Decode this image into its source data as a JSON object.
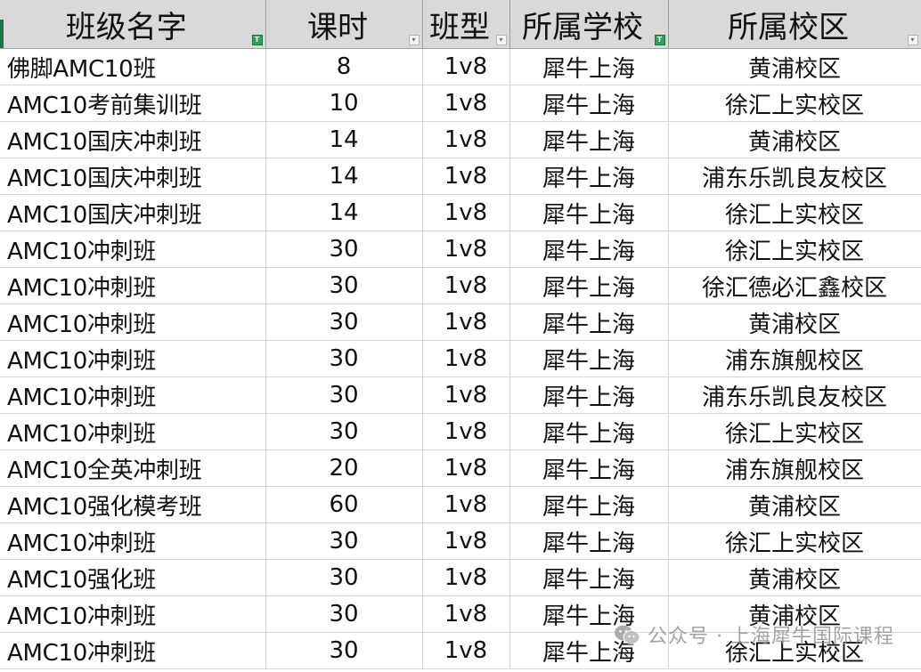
{
  "sheet": {
    "headers": [
      {
        "label": "班级名字",
        "filter_active": true
      },
      {
        "label": "课时",
        "filter_active": false
      },
      {
        "label": "班型",
        "filter_active": false
      },
      {
        "label": "所属学校",
        "filter_active": true
      },
      {
        "label": "所属校区",
        "filter_active": false
      }
    ],
    "rows": [
      [
        "佛脚AMC10班",
        "8",
        "1v8",
        "犀牛上海",
        "黄浦校区"
      ],
      [
        "AMC10考前集训班",
        "10",
        "1v8",
        "犀牛上海",
        "徐汇上实校区"
      ],
      [
        "AMC10国庆冲刺班",
        "14",
        "1v8",
        "犀牛上海",
        "黄浦校区"
      ],
      [
        "AMC10国庆冲刺班",
        "14",
        "1v8",
        "犀牛上海",
        "浦东乐凯良友校区"
      ],
      [
        "AMC10国庆冲刺班",
        "14",
        "1v8",
        "犀牛上海",
        "徐汇上实校区"
      ],
      [
        "AMC10冲刺班",
        "30",
        "1v8",
        "犀牛上海",
        "徐汇上实校区"
      ],
      [
        "AMC10冲刺班",
        "30",
        "1v8",
        "犀牛上海",
        "徐汇德必汇鑫校区"
      ],
      [
        "AMC10冲刺班",
        "30",
        "1v8",
        "犀牛上海",
        "黄浦校区"
      ],
      [
        "AMC10冲刺班",
        "30",
        "1v8",
        "犀牛上海",
        "浦东旗舰校区"
      ],
      [
        "AMC10冲刺班",
        "30",
        "1v8",
        "犀牛上海",
        "浦东乐凯良友校区"
      ],
      [
        "AMC10冲刺班",
        "30",
        "1v8",
        "犀牛上海",
        "徐汇上实校区"
      ],
      [
        "AMC10全英冲刺班",
        "20",
        "1v8",
        "犀牛上海",
        "浦东旗舰校区"
      ],
      [
        "AMC10强化模考班",
        "60",
        "1v8",
        "犀牛上海",
        "黄浦校区"
      ],
      [
        "AMC10冲刺班",
        "30",
        "1v8",
        "犀牛上海",
        "徐汇上实校区"
      ],
      [
        "AMC10强化班",
        "30",
        "1v8",
        "犀牛上海",
        "黄浦校区"
      ],
      [
        "AMC10冲刺班",
        "30",
        "1v8",
        "犀牛上海",
        "黄浦校区"
      ],
      [
        "AMC10冲刺班",
        "30",
        "1v8",
        "犀牛上海",
        "徐汇上实校区"
      ]
    ]
  },
  "icons": {
    "filter_applied": "funnel-filter-icon",
    "filter_dropdown": "dropdown-arrow-icon",
    "watermark": "wechat-icon"
  },
  "colors": {
    "header_bg": "#d9d9d9",
    "filter_active": "#2fa05a",
    "selection_marker": "#217346",
    "grid_line": "#d4d4d4"
  },
  "watermark": {
    "text": "公众号 · 上海犀牛国际课程"
  }
}
